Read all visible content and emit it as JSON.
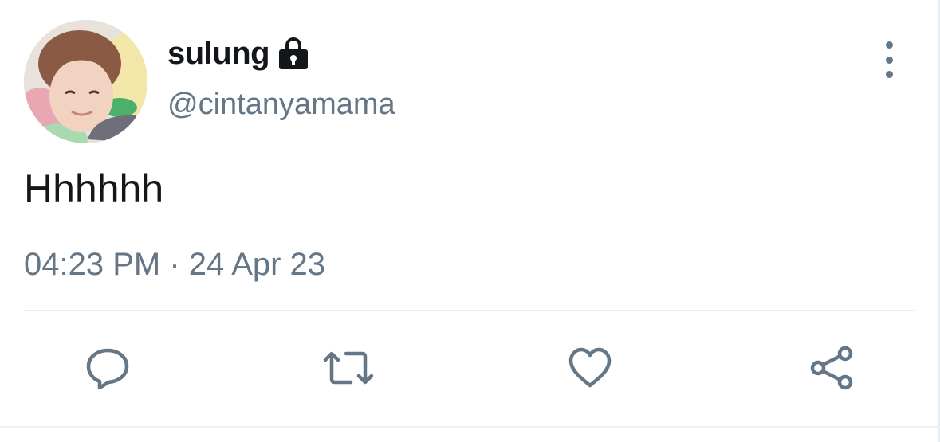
{
  "user": {
    "display_name": "sulung",
    "handle": "@cintanyamama",
    "protected": true,
    "avatar_icon": "profile-photo"
  },
  "tweet": {
    "text": "Hhhhhh",
    "time": "04:23 PM",
    "separator": "·",
    "date": "24 Apr 23"
  },
  "actions": [
    {
      "name": "reply",
      "icon": "comment-bubble-icon"
    },
    {
      "name": "retweet",
      "icon": "retweet-arrows-icon"
    },
    {
      "name": "like",
      "icon": "heart-icon"
    },
    {
      "name": "share",
      "icon": "share-nodes-icon"
    }
  ],
  "colors": {
    "primary_text": "#14171a",
    "secondary_text": "#657786",
    "divider": "#e6ecf0"
  }
}
